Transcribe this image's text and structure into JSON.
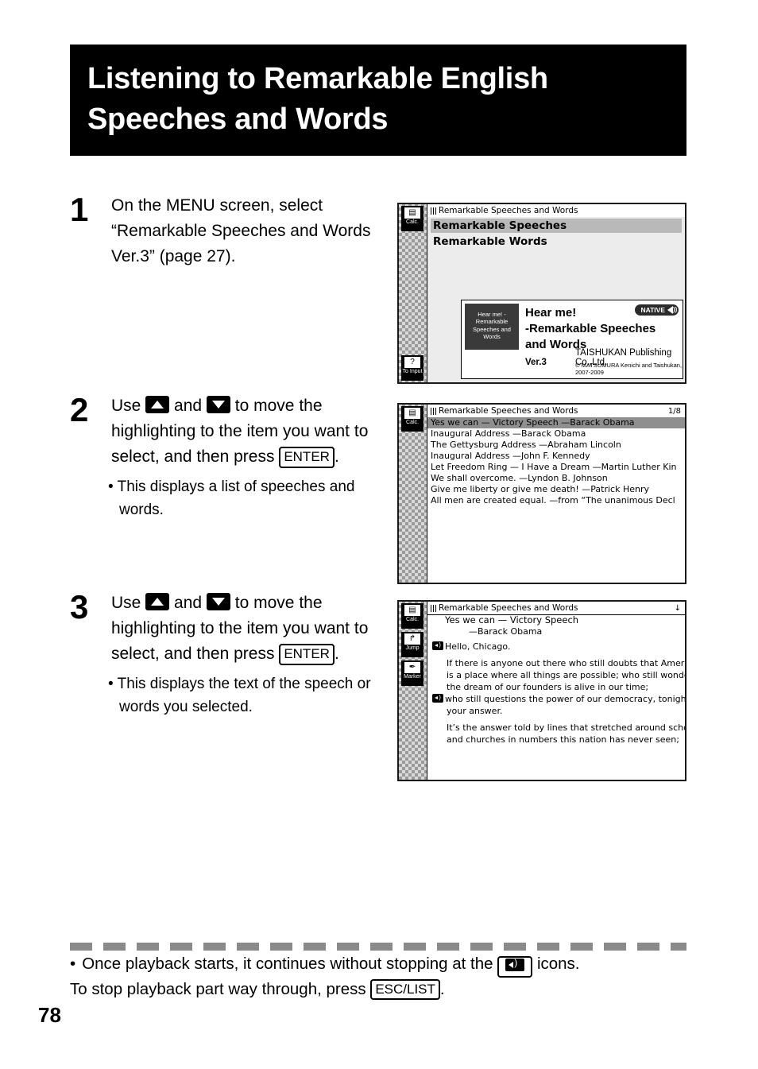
{
  "title": {
    "line1": "Listening to Remarkable English",
    "line2": "Speeches and Words"
  },
  "steps": [
    {
      "num": "1",
      "text_before": "On the MENU screen, select “Remarkable Speeches and Words Ver.3” (page 27).",
      "sub": ""
    },
    {
      "num": "2",
      "use_label": "Use",
      "and_label": "and",
      "tail": "to move the highlighting to the item you want to select, and then press",
      "enter_key": "ENTER",
      "period": ".",
      "sub": "• This displays a list of speeches and words."
    },
    {
      "num": "3",
      "use_label": "Use",
      "and_label": "and",
      "tail": "to move the highlighting to the item you want to select, and then press",
      "enter_key": "ENTER",
      "period": ".",
      "sub": "• This displays the text of the speech or words you selected."
    }
  ],
  "screen1": {
    "titlebar": "Remarkable Speeches and Words",
    "line1": "Remarkable Speeches",
    "line2": "Remarkable Words",
    "rail_top_label": "Calc.",
    "rail_top_glyph": "▤",
    "rail_bottom_label": "To Input",
    "rail_bottom_glyph": "?",
    "thumb_text": "Hear me! -Remarkable Speeches and Words",
    "card_head_l1": "Hear me!",
    "card_head_l2": "-Remarkable Speeches",
    "card_head_l3": "and Words",
    "badge": "NATIVE",
    "version": "Ver.3",
    "publisher": "TAISHUKAN Publishing Co.,Ltd.",
    "copyright": "© MATSUMURA Kenichi and Taishukan, 2007-2009"
  },
  "screen2": {
    "titlebar": "Remarkable Speeches and Words",
    "page_indicator": "1/8",
    "rail_top_label": "Calc.",
    "rail_top_glyph": "▤",
    "rows": [
      {
        "text": "Yes we can — Victory Speech  —Barack Obama",
        "selected": true
      },
      {
        "text": "Inaugural Address  —Barack Obama",
        "selected": false
      },
      {
        "text": "The Gettysburg Address  —Abraham Lincoln",
        "selected": false
      },
      {
        "text": "Inaugural Address  —John F. Kennedy",
        "selected": false
      },
      {
        "text": "Let Freedom Ring — I Have a Dream  —Martin Luther Kin",
        "selected": false
      },
      {
        "text": "We shall overcome. —Lyndon B. Johnson",
        "selected": false
      },
      {
        "text": "Give me liberty or give me death!  —Patrick Henry",
        "selected": false
      },
      {
        "text": "All men are created equal.  —from “The unanimous Decl",
        "selected": false
      }
    ]
  },
  "screen3": {
    "titlebar": "Remarkable Speeches and Words",
    "scroll_marker": "↓",
    "rail_items": [
      {
        "label": "Calc.",
        "glyph": "▤"
      },
      {
        "label": "Jump",
        "glyph": "↱"
      },
      {
        "label": "Marker",
        "glyph": "✒"
      }
    ],
    "title": "Yes we can — Victory Speech",
    "author": "—Barack Obama",
    "first_line": "Hello, Chicago.",
    "paragraphs": [
      [
        "If there is anyone out there who still doubts that America",
        "is a place where all things are possible; who still wonders if",
        "the dream of our founders is alive in our time;"
      ],
      [
        "who still questions the power of our democracy, tonight is",
        "your answer."
      ],
      [
        "It’s the answer told by lines that stretched around schools",
        "and churches in numbers this nation has never seen;"
      ]
    ]
  },
  "footer": {
    "bullet": "•",
    "text_before": "Once playback starts, it continues without stopping at the",
    "text_mid": "icons.",
    "text_after": "To stop playback part way through, press",
    "esc_key": "ESC/LIST",
    "period": "."
  },
  "page_number": "78"
}
